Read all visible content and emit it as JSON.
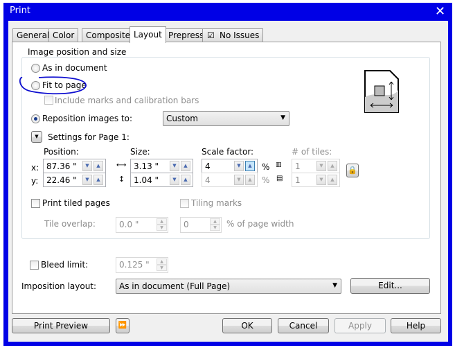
{
  "window": {
    "title": "Print",
    "close": "✕"
  },
  "tabs": [
    {
      "label": "General"
    },
    {
      "label": "Color"
    },
    {
      "label": "Composite"
    },
    {
      "label": "Layout"
    },
    {
      "label": "Prepress"
    },
    {
      "label": "No Issues"
    }
  ],
  "image_position": {
    "legend": "Image position and size",
    "as_in_document": "As in document",
    "fit_to_page": "Fit to page",
    "include_marks": "Include marks and calibration bars",
    "reposition": "Reposition images to:",
    "reposition_value": "Custom",
    "settings_for": "Settings for Page 1:",
    "position_label": "Position:",
    "size_label": "Size:",
    "scale_label": "Scale factor:",
    "tiles_label": "# of tiles:",
    "x_label": "x:",
    "y_label": "y:",
    "x": "87.36 \"",
    "y": "22.46 \"",
    "width": "3.13 \"",
    "height": "1.04 \"",
    "scale_x": "4",
    "scale_y": "4",
    "pct": "%",
    "tiles_x": "1",
    "tiles_y": "1",
    "print_tiled": "Print tiled pages",
    "tiling_marks": "Tiling marks",
    "tile_overlap_label": "Tile overlap:",
    "tile_overlap": "0.0 \"",
    "overlap_pct": "0",
    "pct_page_width": "% of page width"
  },
  "bleed": {
    "label": "Bleed limit:",
    "value": "0.125 \""
  },
  "imposition": {
    "label": "Imposition layout:",
    "value": "As in document (Full Page)",
    "edit": "Edit..."
  },
  "buttons": {
    "preview": "Print Preview",
    "ok": "OK",
    "cancel": "Cancel",
    "apply": "Apply",
    "help": "Help"
  }
}
